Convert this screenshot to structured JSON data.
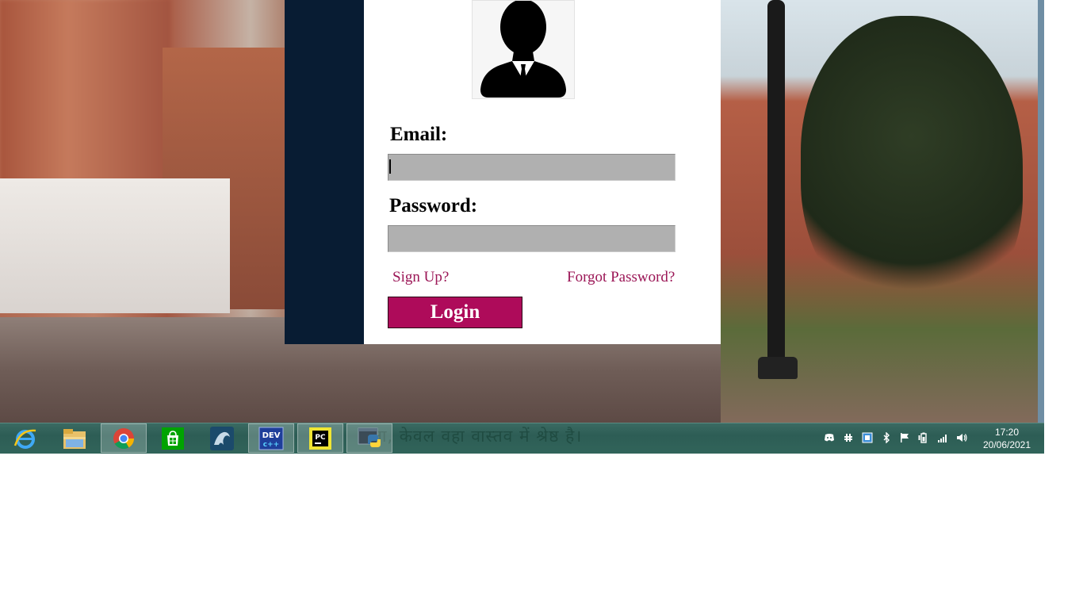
{
  "login": {
    "email_label": "Email:",
    "email_value": "",
    "password_label": "Password:",
    "password_value": "",
    "signup_link": "Sign Up?",
    "forgot_link": "Forgot Password?",
    "login_button": "Login"
  },
  "taskbar": {
    "background_text": "ता, केवल वहा वास्तव में श्रेष्ठ है।",
    "apps": [
      {
        "name": "Internet Explorer",
        "icon": "ie-icon"
      },
      {
        "name": "File Explorer",
        "icon": "folder-icon"
      },
      {
        "name": "Google Chrome",
        "icon": "chrome-icon"
      },
      {
        "name": "Store",
        "icon": "store-icon"
      },
      {
        "name": "MySQL Workbench",
        "icon": "mysql-icon"
      },
      {
        "name": "Dev-C++",
        "icon": "devcpp-icon"
      },
      {
        "name": "PyCharm",
        "icon": "pycharm-icon"
      },
      {
        "name": "Python",
        "icon": "python-icon"
      }
    ],
    "time": "17:20",
    "date": "20/06/2021"
  },
  "colors": {
    "sidebar": "#081c33",
    "login_button": "#ae0b5a",
    "links": "#9b1656",
    "field_bg": "#b0b0b0"
  }
}
